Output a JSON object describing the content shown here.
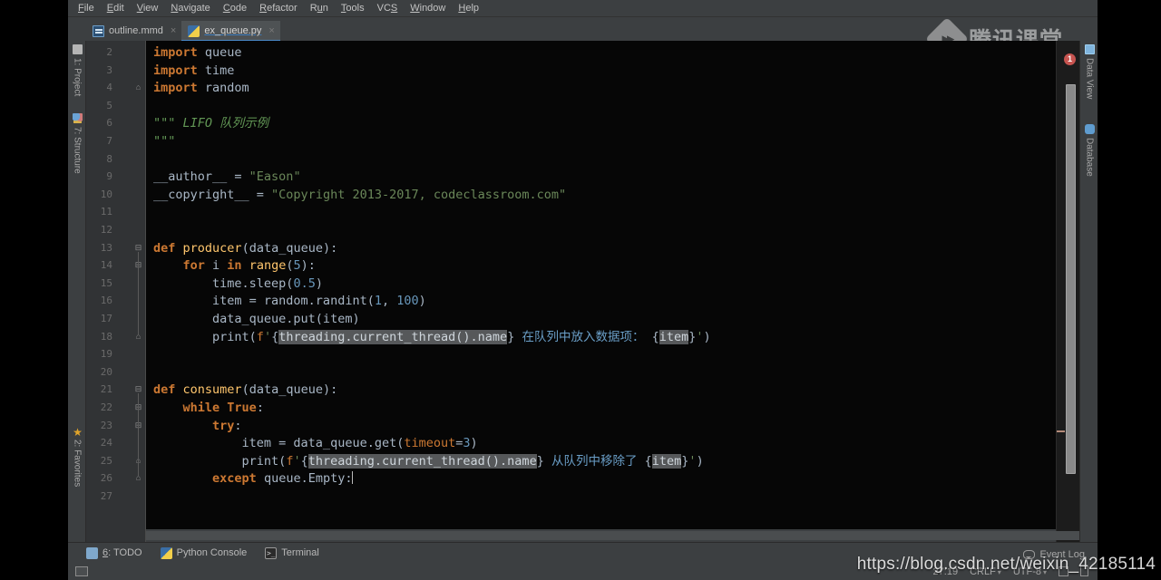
{
  "app": {
    "name": "PyCharm",
    "accent_color": "#4a88c7",
    "error_color": "#c75450",
    "editor_bg": "#060606",
    "chrome_bg": "#3c3f41"
  },
  "menubar": {
    "items": [
      {
        "label": "File",
        "accel": "F"
      },
      {
        "label": "Edit",
        "accel": "E"
      },
      {
        "label": "View",
        "accel": "V"
      },
      {
        "label": "Navigate",
        "accel": "N"
      },
      {
        "label": "Code",
        "accel": "C"
      },
      {
        "label": "Refactor",
        "accel": "R"
      },
      {
        "label": "Run",
        "accel": "u"
      },
      {
        "label": "Tools",
        "accel": "T"
      },
      {
        "label": "VCS",
        "accel": "S"
      },
      {
        "label": "Window",
        "accel": "W"
      },
      {
        "label": "Help",
        "accel": "H"
      }
    ]
  },
  "tabs": [
    {
      "label": "outline.mmd",
      "icon": "mermaid-file-icon",
      "active": false,
      "close": "×"
    },
    {
      "label": "ex_queue.py",
      "icon": "python-file-icon",
      "active": true,
      "close": "×"
    }
  ],
  "watermarks": {
    "tencent_text": "腾讯课堂",
    "tencent_icon": "tencent-classroom-logo",
    "csdn_url": "https://blog.csdn.net/weixin_42185114"
  },
  "left_stripe": [
    {
      "label": "1: Project",
      "icon": "project-icon"
    },
    {
      "label": "7: Structure",
      "icon": "structure-icon"
    },
    {
      "label": "2: Favorites",
      "icon": "star-icon"
    }
  ],
  "right_stripe": [
    {
      "label": "Data View",
      "icon": "data-view-icon"
    },
    {
      "label": "Database",
      "icon": "database-icon"
    }
  ],
  "editor": {
    "first_line": 2,
    "last_line": 27,
    "error_badge": "1",
    "lines": [
      {
        "n": 2,
        "html": "<span class=\"kw\">import</span> queue"
      },
      {
        "n": 3,
        "html": "<span class=\"kw\">import</span> time"
      },
      {
        "n": 4,
        "html": "<span class=\"kw\">import</span> random"
      },
      {
        "n": 5,
        "html": ""
      },
      {
        "n": 6,
        "html": "<span class=\"doc\">\"\"\" LIFO 队列示例</span>"
      },
      {
        "n": 7,
        "html": "<span class=\"doc\">\"\"\"</span>"
      },
      {
        "n": 8,
        "html": ""
      },
      {
        "n": 9,
        "html": "__author__ = <span class=\"str\">\"Eason\"</span>"
      },
      {
        "n": 10,
        "html": "__copyright__ = <span class=\"str\">\"Copyright 2013-2017, codeclassroom.com\"</span>"
      },
      {
        "n": 11,
        "html": ""
      },
      {
        "n": 12,
        "html": ""
      },
      {
        "n": 13,
        "html": "<span class=\"kw\">def</span> <span class=\"fn\">producer</span>(data_queue):"
      },
      {
        "n": 14,
        "html": "    <span class=\"kw\">for</span> i <span class=\"kw\">in</span> <span class=\"fn\">range</span>(<span class=\"num\">5</span>):"
      },
      {
        "n": 15,
        "html": "        time.sleep(<span class=\"num\">0.5</span>)"
      },
      {
        "n": 16,
        "html": "        item = random.randint(<span class=\"num\">1</span>, <span class=\"num\">100</span>)"
      },
      {
        "n": 17,
        "html": "        data_queue.put(item)"
      },
      {
        "n": 18,
        "html": "        print(<span class=\"pfx\">f</span><span class=\"str\">'</span><span class=\"brace\">{</span><span class=\"sel\">threading.current_thread().name</span><span class=\"brace\">}</span> <span class=\"cjk\">在队列中放入数据项：</span> <span class=\"brace\">{</span><span class=\"sel\">item</span><span class=\"brace\">}</span><span class=\"str\">'</span>)"
      },
      {
        "n": 19,
        "html": ""
      },
      {
        "n": 20,
        "html": ""
      },
      {
        "n": 21,
        "html": "<span class=\"kw\">def</span> <span class=\"fn\">consumer</span>(data_queue):"
      },
      {
        "n": 22,
        "html": "    <span class=\"kw\">while</span> <span class=\"kw\">True</span>:"
      },
      {
        "n": 23,
        "html": "        <span class=\"kw\">try</span>:"
      },
      {
        "n": 24,
        "html": "            item = data_queue.get(<span class=\"kwarg\">timeout</span>=<span class=\"num\">3</span>)"
      },
      {
        "n": 25,
        "html": "            print(<span class=\"pfx\">f</span><span class=\"str\">'</span><span class=\"brace\">{</span><span class=\"sel\">threading.current_thread().name</span><span class=\"brace\">}</span> <span class=\"cjk\">从队列中移除了</span> <span class=\"brace\">{</span><span class=\"sel\">item</span><span class=\"brace\">}</span><span class=\"str\">'</span>)"
      },
      {
        "n": 26,
        "html": "        <span class=\"kw\">except</span> queue.Empty:<span class=\"caret\"></span>"
      },
      {
        "n": 27,
        "html": ""
      }
    ],
    "plain_lines": [
      "import queue",
      "import time",
      "import random",
      "",
      "\"\"\" LIFO 队列示例",
      "\"\"\"",
      "",
      "__author__ = \"Eason\"",
      "__copyright__ = \"Copyright 2013-2017, codeclassroom.com\"",
      "",
      "",
      "def producer(data_queue):",
      "    for i in range(5):",
      "        time.sleep(0.5)",
      "        item = random.randint(1, 100)",
      "        data_queue.put(item)",
      "        print(f'{threading.current_thread().name} 在队列中放入数据项： {item}')",
      "",
      "",
      "def consumer(data_queue):",
      "    while True:",
      "        try:",
      "            item = data_queue.get(timeout=3)",
      "            print(f'{threading.current_thread().name} 从队列中移除了 {item}')",
      "        except queue.Empty:",
      ""
    ]
  },
  "bottom_tools": [
    {
      "label": "6: TODO",
      "accel": "6",
      "icon": "todo-icon"
    },
    {
      "label": "Python Console",
      "accel": "",
      "icon": "python-console-icon"
    },
    {
      "label": "Terminal",
      "accel": "",
      "icon": "terminal-icon"
    }
  ],
  "status": {
    "event_log": "Event Log",
    "caret_position": "27:19",
    "line_separator": "CRLF",
    "encoding": "UTF-8",
    "lock_icon": "read-only-toggle-icon",
    "inspection_icon": "inspection-trash-icon"
  }
}
